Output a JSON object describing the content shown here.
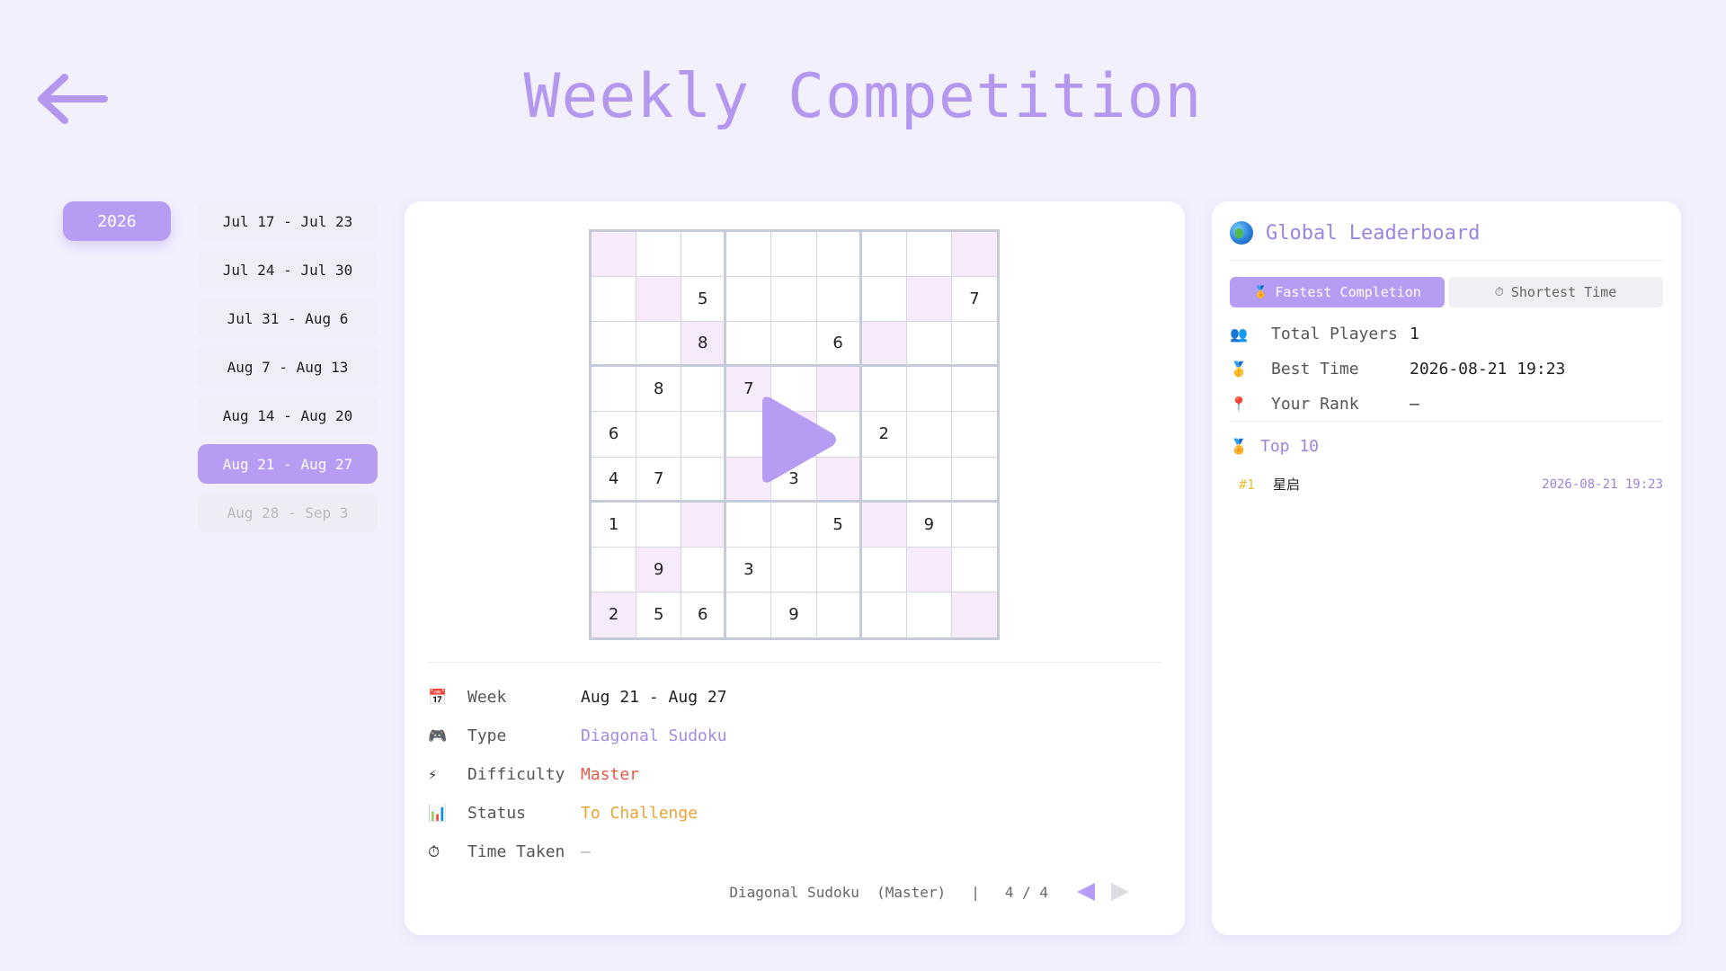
{
  "header": {
    "title": "Weekly Competition"
  },
  "sidebar": {
    "year": "2026",
    "weeks": [
      {
        "label": "Jul 17 - Jul 23",
        "state": "normal"
      },
      {
        "label": "Jul 24 - Jul 30",
        "state": "normal"
      },
      {
        "label": "Jul 31 - Aug 6",
        "state": "normal"
      },
      {
        "label": "Aug 7 - Aug 13",
        "state": "normal"
      },
      {
        "label": "Aug 14 - Aug 20",
        "state": "normal"
      },
      {
        "label": "Aug 21 - Aug 27",
        "state": "active"
      },
      {
        "label": "Aug 28 - Sep 3",
        "state": "disabled"
      }
    ]
  },
  "puzzle": {
    "grid": [
      [
        "",
        "",
        "",
        "",
        "",
        "",
        "",
        "",
        ""
      ],
      [
        "",
        "",
        "5",
        "",
        "",
        "",
        "",
        "",
        "7"
      ],
      [
        "",
        "",
        "8",
        "",
        "",
        "6",
        "",
        "",
        ""
      ],
      [
        "",
        "8",
        "",
        "7",
        "",
        "",
        "",
        "",
        ""
      ],
      [
        "6",
        "",
        "",
        "",
        "",
        "",
        "2",
        "",
        ""
      ],
      [
        "4",
        "7",
        "",
        "",
        "3",
        "",
        "",
        "",
        ""
      ],
      [
        "1",
        "",
        "",
        "",
        "",
        "5",
        "",
        "9",
        ""
      ],
      [
        "",
        "9",
        "",
        "3",
        "",
        "",
        "",
        "",
        ""
      ],
      [
        "2",
        "5",
        "6",
        "",
        "9",
        "",
        "",
        "",
        ""
      ]
    ]
  },
  "info": {
    "week": {
      "icon": "📅",
      "label": "Week",
      "value": "Aug 21 - Aug 27"
    },
    "type": {
      "icon": "🎮",
      "label": "Type",
      "value": "Diagonal Sudoku"
    },
    "difficulty": {
      "icon": "⚡",
      "label": "Difficulty",
      "value": "Master"
    },
    "status": {
      "icon": "📊",
      "label": "Status",
      "value": "To Challenge"
    },
    "time_taken": {
      "icon": "⏱",
      "label": "Time Taken",
      "value": "—"
    }
  },
  "pager": {
    "summary": "Diagonal Sudoku  (Master)",
    "separator": "|",
    "position": "4 / 4"
  },
  "leaderboard": {
    "title": "Global Leaderboard",
    "tabs": [
      {
        "icon": "🏅",
        "label": "Fastest Completion"
      },
      {
        "icon": "⏱",
        "label": "Shortest Time"
      }
    ],
    "stats": {
      "total_players": {
        "icon": "👥",
        "label": "Total Players",
        "value": "1"
      },
      "best_time": {
        "icon": "🥇",
        "label": "Best Time",
        "value": "2026-08-21 19:23"
      },
      "your_rank": {
        "icon": "📍",
        "label": "Your Rank",
        "value": "—"
      }
    },
    "top_title": {
      "icon": "🏅",
      "label": "Top 10"
    },
    "entries": [
      {
        "rank": "#1",
        "name": "星启",
        "time": "2026-08-21 19:23"
      }
    ]
  },
  "colors": {
    "accent": "#b69cf2",
    "title": "#b497ee",
    "difficulty": "#e05b4b",
    "status": "#e7a436",
    "diagonal_cell": "#f7eafb"
  }
}
